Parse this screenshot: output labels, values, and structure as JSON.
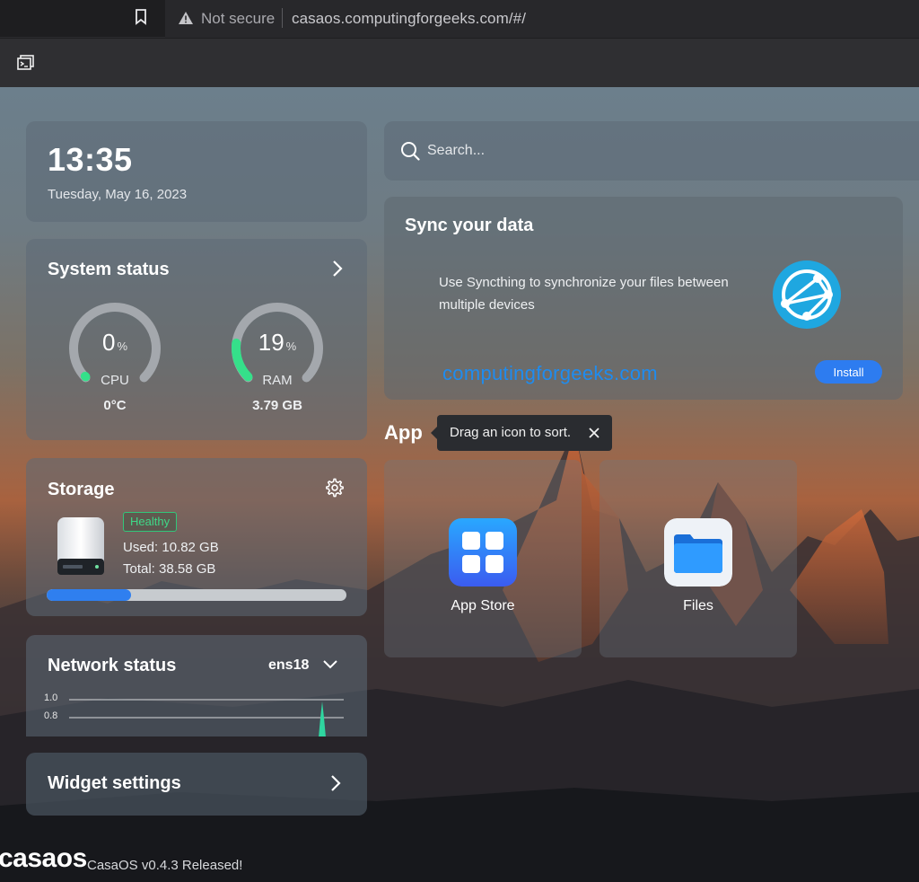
{
  "browser": {
    "security_label": "Not secure",
    "url": "casaos.computingforgeeks.com/#/"
  },
  "clock": {
    "time": "13:35",
    "date": "Tuesday, May 16, 2023"
  },
  "system_status": {
    "title": "System status",
    "cpu": {
      "value": "0",
      "unit": "%",
      "label": "CPU",
      "sub": "0°C",
      "percent": 0
    },
    "ram": {
      "value": "19",
      "unit": "%",
      "label": "RAM",
      "sub": "3.79 GB",
      "percent": 19
    }
  },
  "storage": {
    "title": "Storage",
    "health": "Healthy",
    "used": "Used: 10.82 GB",
    "total": "Total: 38.58 GB",
    "used_fraction": 0.28
  },
  "network": {
    "title": "Network status",
    "interface": "ens18",
    "y_ticks": [
      "1.0",
      "0.8"
    ]
  },
  "widget_settings": {
    "title": "Widget settings"
  },
  "search": {
    "placeholder": "Search..."
  },
  "sync": {
    "title": "Sync your data",
    "description": "Use Syncthing to synchronize your files between multiple devices",
    "watermark": "computingforgeeks.com",
    "install_label": "Install"
  },
  "apps": {
    "heading": "App",
    "tooltip": "Drag an icon to sort.",
    "items": [
      {
        "label": "App Store",
        "icon": "app-store-icon"
      },
      {
        "label": "Files",
        "icon": "files-folder-icon"
      }
    ]
  },
  "footer": {
    "logo": "casaos",
    "release": "CasaOS v0.4.3 Released!"
  },
  "colors": {
    "accent": "#2d7cf0",
    "gauge_green": "#35e08a",
    "healthy": "#3fd888"
  }
}
